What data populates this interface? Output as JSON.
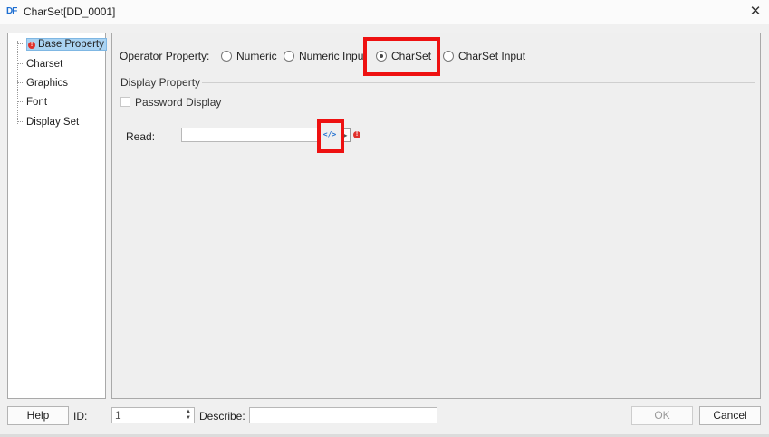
{
  "window": {
    "logo_text": "DF",
    "title": "CharSet[DD_0001]",
    "close_glyph": "✕"
  },
  "nav_tree": {
    "items": [
      {
        "label": "Base Property",
        "selected": true,
        "has_error": true
      },
      {
        "label": "Charset",
        "selected": false,
        "has_error": false
      },
      {
        "label": "Graphics",
        "selected": false,
        "has_error": false
      },
      {
        "label": "Font",
        "selected": false,
        "has_error": false
      },
      {
        "label": "Display Set",
        "selected": false,
        "has_error": false
      }
    ],
    "error_glyph": "!"
  },
  "operator_property": {
    "label": "Operator Property:",
    "options": [
      {
        "label": "Numeric",
        "checked": false
      },
      {
        "label": "Numeric Input",
        "checked": false
      },
      {
        "label": "CharSet",
        "checked": true
      },
      {
        "label": "CharSet Input",
        "checked": false
      }
    ]
  },
  "display_property": {
    "header": "Display Property",
    "password_display_label": "Password Display",
    "password_display_checked": false
  },
  "read_field": {
    "label": "Read:",
    "value": "",
    "code_button_glyph": "</>",
    "small_button_glyph": "▸",
    "error_glyph": "!"
  },
  "footer": {
    "help_label": "Help",
    "id_label": "ID:",
    "id_value": "1",
    "spin_up": "▲",
    "spin_down": "▼",
    "describe_label": "Describe:",
    "describe_value": "",
    "ok_label": "OK",
    "cancel_label": "Cancel"
  },
  "colors": {
    "highlight": "#ee1111",
    "accent": "#1f6fd1",
    "error": "#e0302b",
    "selection": "#aad3f2"
  }
}
